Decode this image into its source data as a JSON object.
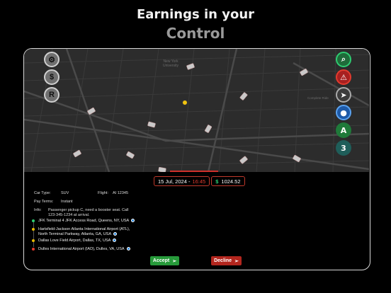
{
  "headline": {
    "line1": "Earnings in your",
    "line2": "Control"
  },
  "map_labels": [
    {
      "text": "New York University"
    },
    {
      "text": "Complete Ride"
    }
  ],
  "left_buttons": [
    {
      "name": "settings-button",
      "icon": "gear-icon",
      "glyph": "⚙"
    },
    {
      "name": "earnings-button",
      "icon": "dollar-icon",
      "glyph": "$"
    },
    {
      "name": "rewards-button",
      "icon": "r-badge-icon",
      "glyph": "R"
    }
  ],
  "right_buttons": [
    {
      "name": "search-button",
      "icon": "search-icon",
      "glyph": "⌕",
      "color": "#1f6b3a"
    },
    {
      "name": "ride-alert-button",
      "icon": "car-alert-icon",
      "glyph": "⚠",
      "color": "#a82020"
    },
    {
      "name": "navigate-button",
      "icon": "send-icon",
      "glyph": "➤",
      "color": "#3c3c3c"
    },
    {
      "name": "location-button",
      "icon": "location-pin-icon",
      "glyph": "●",
      "color": "#1e5aa8"
    },
    {
      "name": "mode-a-button",
      "icon": "letter-a-icon",
      "glyph": "A",
      "color": "#1f7a3a"
    },
    {
      "name": "mode-3-button",
      "icon": "number-3-icon",
      "glyph": "3",
      "color": "#1f5e5a"
    }
  ],
  "trip": {
    "date": "15 Jul, 2024 -",
    "time": "16:45",
    "currency": "$",
    "earnings": "1024.52"
  },
  "details": {
    "car_type_label": "Car Type:",
    "car_type": "SUV",
    "flight_label": "Flight:",
    "flight": "AI 12345",
    "pay_terms_label": "Pay Terms:",
    "pay_terms": "Instant",
    "info_label": "Info:",
    "info": "Passenger pickup C, need a booster seat. Call 123-345-1234 at arrival."
  },
  "stops": [
    {
      "text": "JFK Terminal 4 JFK Access Road, Queens, NY, USA",
      "color": "#2ecc71"
    },
    {
      "text": "Hartsfield-Jackson Atlanta International Airport (ATL), North Terminal Parkway, Atlanta, GA, USA",
      "color": "#e6b800"
    },
    {
      "text": "Dallas Love Field Airport, Dallas, TX, USA",
      "color": "#e6b800"
    },
    {
      "text": "Dulles International Airport (IAD), Dulles, VA, USA",
      "color": "#e23b2e"
    }
  ],
  "actions": {
    "accept": "Accept",
    "decline": "Decline"
  },
  "colors": {
    "accent_red": "#d0302b",
    "accept_green": "#279a3a",
    "decline_red": "#b3261e"
  }
}
